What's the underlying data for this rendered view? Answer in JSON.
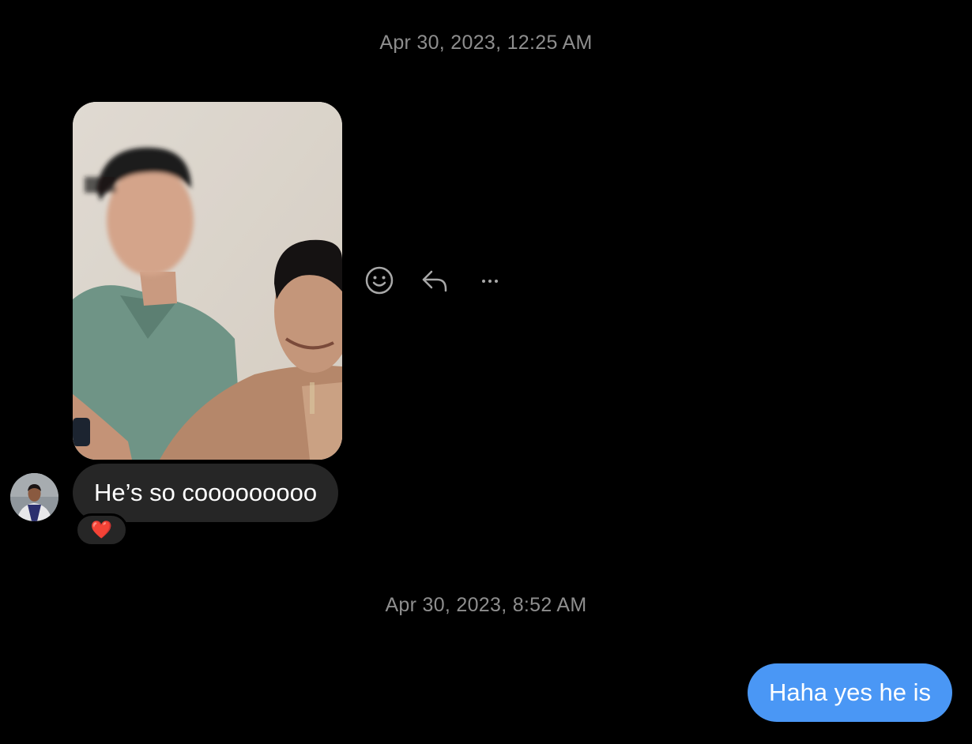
{
  "thread": {
    "timestamps": [
      "Apr 30, 2023, 12:25 AM",
      "Apr 30, 2023, 8:52 AM"
    ],
    "incoming": {
      "photo_icon": "photo-attachment",
      "text": "He’s so cooooooooo",
      "reaction": "❤️"
    },
    "actions": {
      "react_icon": "smiley-icon",
      "reply_icon": "reply-arrow-icon",
      "more_icon": "more-dots-icon"
    },
    "outgoing": {
      "text": "Haha yes he is"
    }
  },
  "colors": {
    "background": "#000000",
    "incoming_bubble": "#262626",
    "outgoing_bubble": "#4a97f5",
    "timestamp": "#8e8e8e",
    "icon": "#a8a8a8"
  }
}
